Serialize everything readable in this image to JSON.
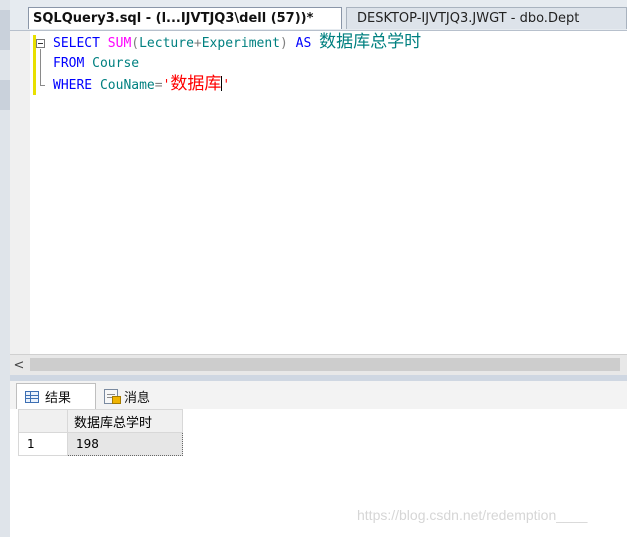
{
  "tabs": {
    "active": "SQLQuery3.sql - (l...IJVTJQ3\\dell (57))*",
    "inactive": "DESKTOP-IJVTJQ3.JWGT - dbo.Dept"
  },
  "editor": {
    "line1": {
      "kw_select": "SELECT",
      "fn_sum": "SUM",
      "paren_open": "(",
      "arg1": "Lecture",
      "op_plus": "+",
      "arg2": "Experiment",
      "paren_close": ")",
      "kw_as": "AS",
      "alias": "数据库总学时"
    },
    "line2": {
      "kw_from": "FROM",
      "table": "Course"
    },
    "line3": {
      "kw_where": "WHERE",
      "column": "CouName",
      "op_eq": "=",
      "quote_open": "'",
      "value": "数据库",
      "quote_close": "'"
    }
  },
  "scroll": {
    "left_arrow": "<"
  },
  "results": {
    "tab_results": "结果",
    "tab_messages": "消息",
    "columns": [
      "数据库总学时"
    ],
    "rows": [
      {
        "num": "1",
        "values": [
          "198"
        ]
      }
    ]
  },
  "watermark": "https://blog.csdn.net/redemption____",
  "colors": {
    "keyword": "#0000ff",
    "function": "#ff00ff",
    "identifier": "#008080",
    "string": "#ff0000",
    "modified_marker": "#e8e000"
  },
  "icons": [
    "results-grid-icon",
    "messages-icon",
    "collapse-icon",
    "scroll-left-icon"
  ]
}
